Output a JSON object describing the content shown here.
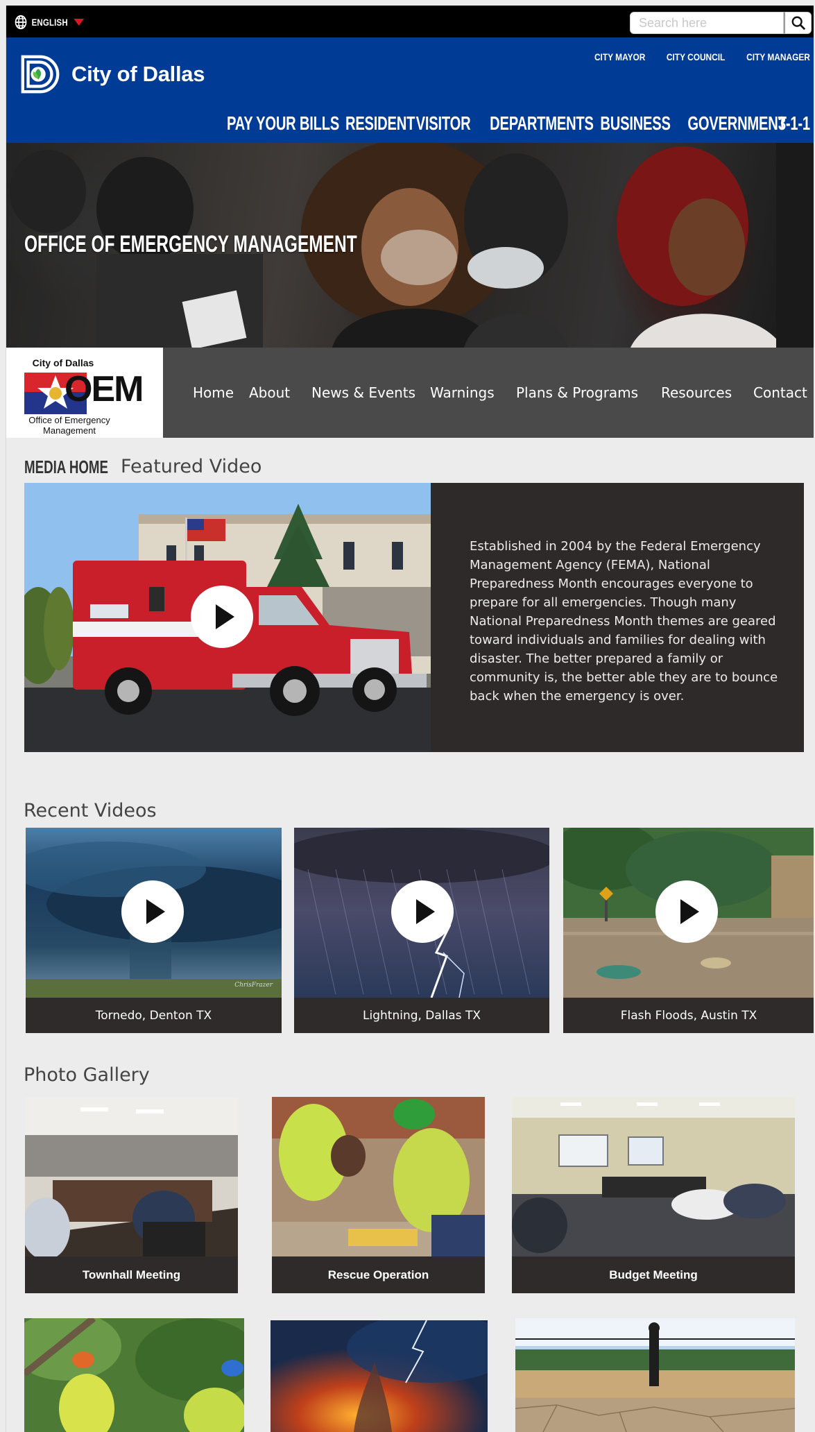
{
  "topbar": {
    "language_label": "ENGLISH",
    "search_placeholder": "Search here"
  },
  "header": {
    "site_name": "City of Dallas",
    "utility_links": [
      "CITY MAYOR",
      "CITY COUNCIL",
      "CITY MANAGER"
    ],
    "nav_items": [
      "PAY YOUR BILLS",
      "RESIDENT",
      "VISITOR",
      "DEPARTMENTS",
      "BUSINESS",
      "GOVERNMENT",
      "3-1-1"
    ]
  },
  "hero": {
    "title": "OFFICE OF EMERGENCY MANAGEMENT"
  },
  "oem": {
    "logo_top": "City of Dallas",
    "logo_letters": "OEM",
    "logo_sub_1": "Office of Emergency",
    "logo_sub_2": "Management",
    "nav_items": [
      "Home",
      "About",
      "News & Events",
      "Warnings",
      "Plans & Programs",
      "Resources",
      "Contact"
    ]
  },
  "featured": {
    "media_home": "MEDIA HOME",
    "title": "Featured Video",
    "description": "Established in 2004 by the Federal Emergency Management Agency (FEMA), National Preparedness Month encourages everyone to prepare for all emergencies. Though many National Preparedness Month themes are geared toward individuals and families for dealing with disaster. The better prepared a family or community is, the better able they are to bounce back when the emergency is over."
  },
  "recent_videos": {
    "title": "Recent Videos",
    "items": [
      {
        "caption": "Tornedo, Denton TX",
        "watermark": "ChrisFrazer"
      },
      {
        "caption": "Lightning, Dallas TX"
      },
      {
        "caption": "Flash Floods, Austin TX"
      }
    ]
  },
  "photo_gallery": {
    "title": "Photo Gallery",
    "items": [
      {
        "caption": "Townhall Meeting"
      },
      {
        "caption": "Rescue Operation"
      },
      {
        "caption": "Budget Meeting"
      }
    ]
  },
  "colors": {
    "header_blue": "#003b95",
    "topbar_black": "#000000",
    "nav_gray": "#4a4a4a",
    "caption_dark": "#2f2b2b",
    "accent_red": "#e0161f"
  },
  "icons": {
    "language": "globe-icon",
    "dropdown": "caret-down-icon",
    "search": "magnifier-icon",
    "play": "play-icon"
  }
}
